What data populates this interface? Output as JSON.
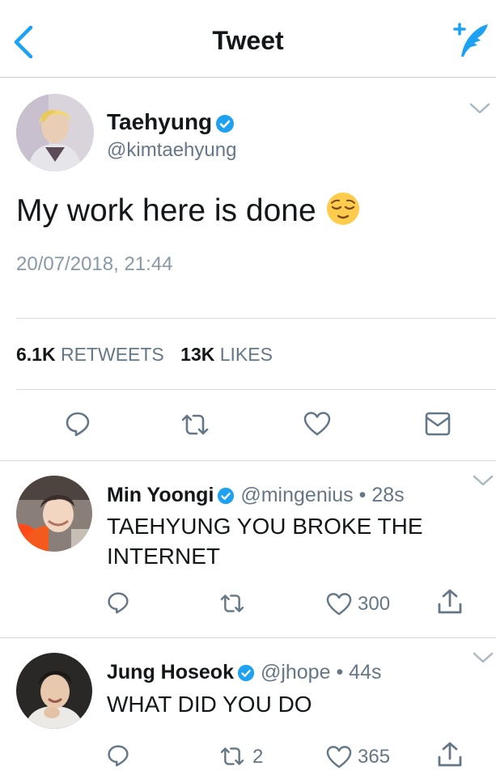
{
  "header": {
    "title": "Tweet",
    "back_icon": "chevron-left-icon",
    "compose_icon": "compose-tweet-icon",
    "accent": "#1da1f2"
  },
  "main_tweet": {
    "name": "Taehyung",
    "handle": "@kimtaehyung",
    "verified": true,
    "text": "My work here is done",
    "emoji": "relieved-face-emoji",
    "timestamp": "20/07/2018, 21:44",
    "retweets_count": "6.1K",
    "retweets_label": "RETWEETS",
    "likes_count": "13K",
    "likes_label": "LIKES",
    "actions": [
      "reply-icon",
      "retweet-icon",
      "like-icon",
      "message-icon"
    ]
  },
  "replies": [
    {
      "name": "Min Yoongi",
      "handle": "@mingenius",
      "dot": "•",
      "time": "28s",
      "verified": true,
      "text": "TAEHYUNG YOU BROKE THE INTERNET",
      "retweets": "",
      "likes": "300"
    },
    {
      "name": "Jung Hoseok",
      "handle": "@jhope",
      "dot": "•",
      "time": "44s",
      "verified": true,
      "text": "WHAT DID YOU DO",
      "retweets": "2",
      "likes": "365"
    }
  ]
}
